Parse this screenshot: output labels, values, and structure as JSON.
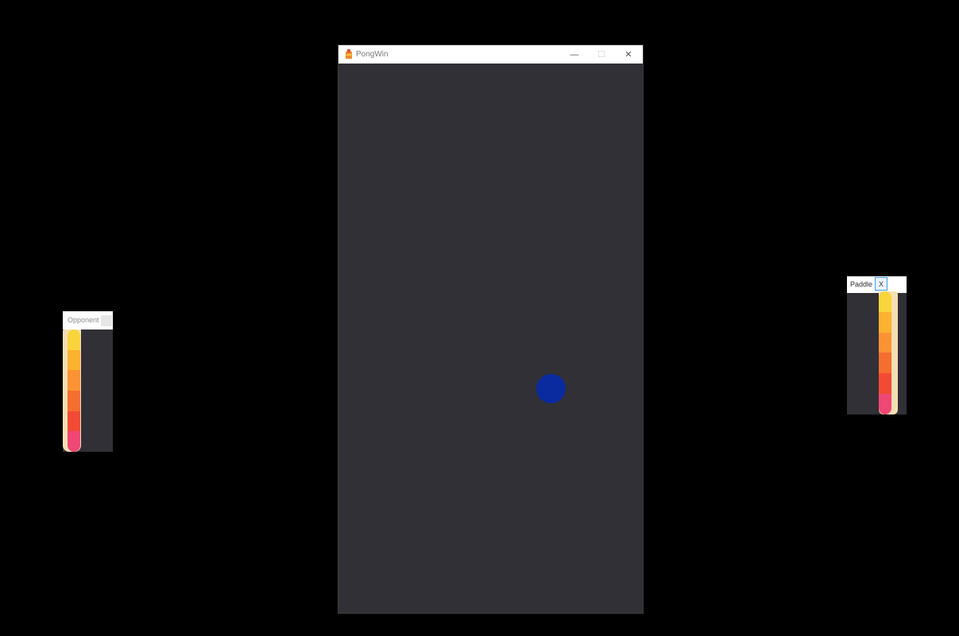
{
  "main_window": {
    "title": "PongWin",
    "minimize_glyph": "—",
    "maximize_glyph": "☐",
    "close_glyph": "✕"
  },
  "opponent_window": {
    "title": "Opponent"
  },
  "paddle_window": {
    "title": "Paddle",
    "close_label": "X"
  },
  "colors": {
    "background": "#000000",
    "game_area": "#313036",
    "ball": "#0a2aa0",
    "paddle_frame": "#f5deb3",
    "paddle_segments": [
      "#f9d43c",
      "#fbb22f",
      "#fb9335",
      "#f56e30",
      "#f24a35",
      "#f04774"
    ]
  }
}
